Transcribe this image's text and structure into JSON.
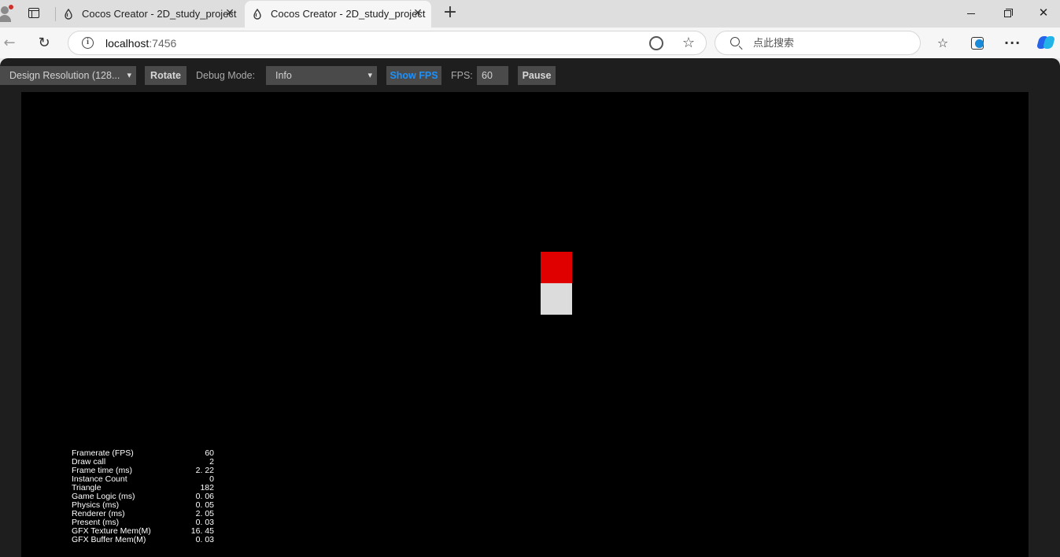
{
  "browser": {
    "tabs": [
      {
        "title": "Cocos Creator - 2D_study_project",
        "active": false
      },
      {
        "title": "Cocos Creator - 2D_study_project",
        "active": true
      }
    ],
    "address": {
      "host": "localhost",
      "port": ":7456"
    },
    "search_placeholder": "点此搜索"
  },
  "cocos_toolbar": {
    "design_resolution": "Design Resolution (128...",
    "rotate_label": "Rotate",
    "debug_mode_label": "Debug Mode:",
    "debug_mode_value": "Info",
    "show_fps_label": "Show FPS",
    "fps_label": "FPS:",
    "fps_value": "60",
    "pause_label": "Pause"
  },
  "stats": [
    {
      "label": "Framerate (FPS)",
      "value": "60"
    },
    {
      "label": "Draw call",
      "value": "2"
    },
    {
      "label": "Frame time (ms)",
      "value": "2. 22"
    },
    {
      "label": "Instance Count",
      "value": "0"
    },
    {
      "label": "Triangle",
      "value": "182"
    },
    {
      "label": "Game Logic (ms)",
      "value": "0. 06"
    },
    {
      "label": "Physics (ms)",
      "value": "0. 05"
    },
    {
      "label": "Renderer (ms)",
      "value": "2. 05"
    },
    {
      "label": "Present (ms)",
      "value": "0. 03"
    },
    {
      "label": "GFX Texture Mem(M)",
      "value": "16. 45"
    },
    {
      "label": "GFX Buffer Mem(M)",
      "value": "0. 03"
    }
  ],
  "colors": {
    "sprite_top": "#e00000",
    "sprite_bottom": "#dcdcdc",
    "show_fps_accent": "#1a92ff"
  }
}
